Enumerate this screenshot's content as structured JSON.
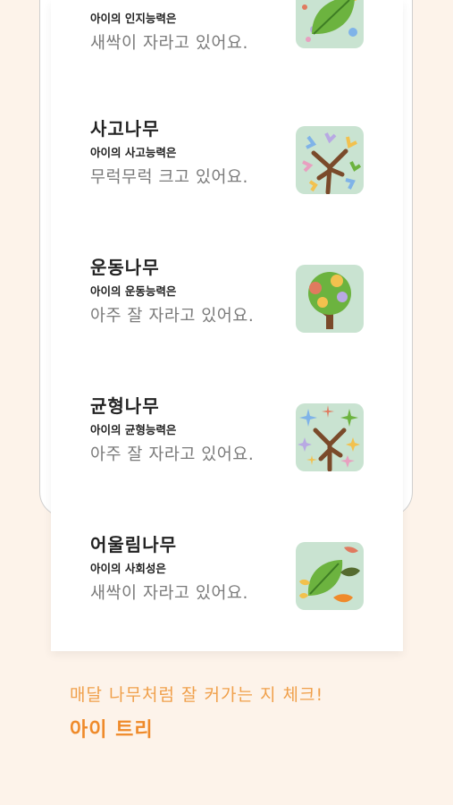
{
  "items": [
    {
      "title": "",
      "subtitle": "아이의 인지능력은",
      "status": "새싹이 자라고 있어요.",
      "icon": "leaf-dots-icon"
    },
    {
      "title": "사고나무",
      "subtitle": "아이의 사고능력은",
      "status": "무럭무럭 크고 있어요.",
      "icon": "branch-tree-icon"
    },
    {
      "title": "운동나무",
      "subtitle": "아이의 운동능력은",
      "status": "아주 잘 자라고 있어요.",
      "icon": "round-tree-icon"
    },
    {
      "title": "균형나무",
      "subtitle": "아이의 균형능력은",
      "status": "아주 잘 자라고 있어요.",
      "icon": "sparkle-tree-icon"
    },
    {
      "title": "어울림나무",
      "subtitle": "아이의 사회성은",
      "status": "새싹이 자라고 있어요.",
      "icon": "leaves-icon"
    }
  ],
  "footer": {
    "tagline": "매달 나무처럼 잘 커가는 지 체크!",
    "brand": "아이 트리"
  },
  "colors": {
    "background": "#fdf3ea",
    "accent": "#ef8a2a",
    "icon_bg": "#c9e3d1"
  }
}
